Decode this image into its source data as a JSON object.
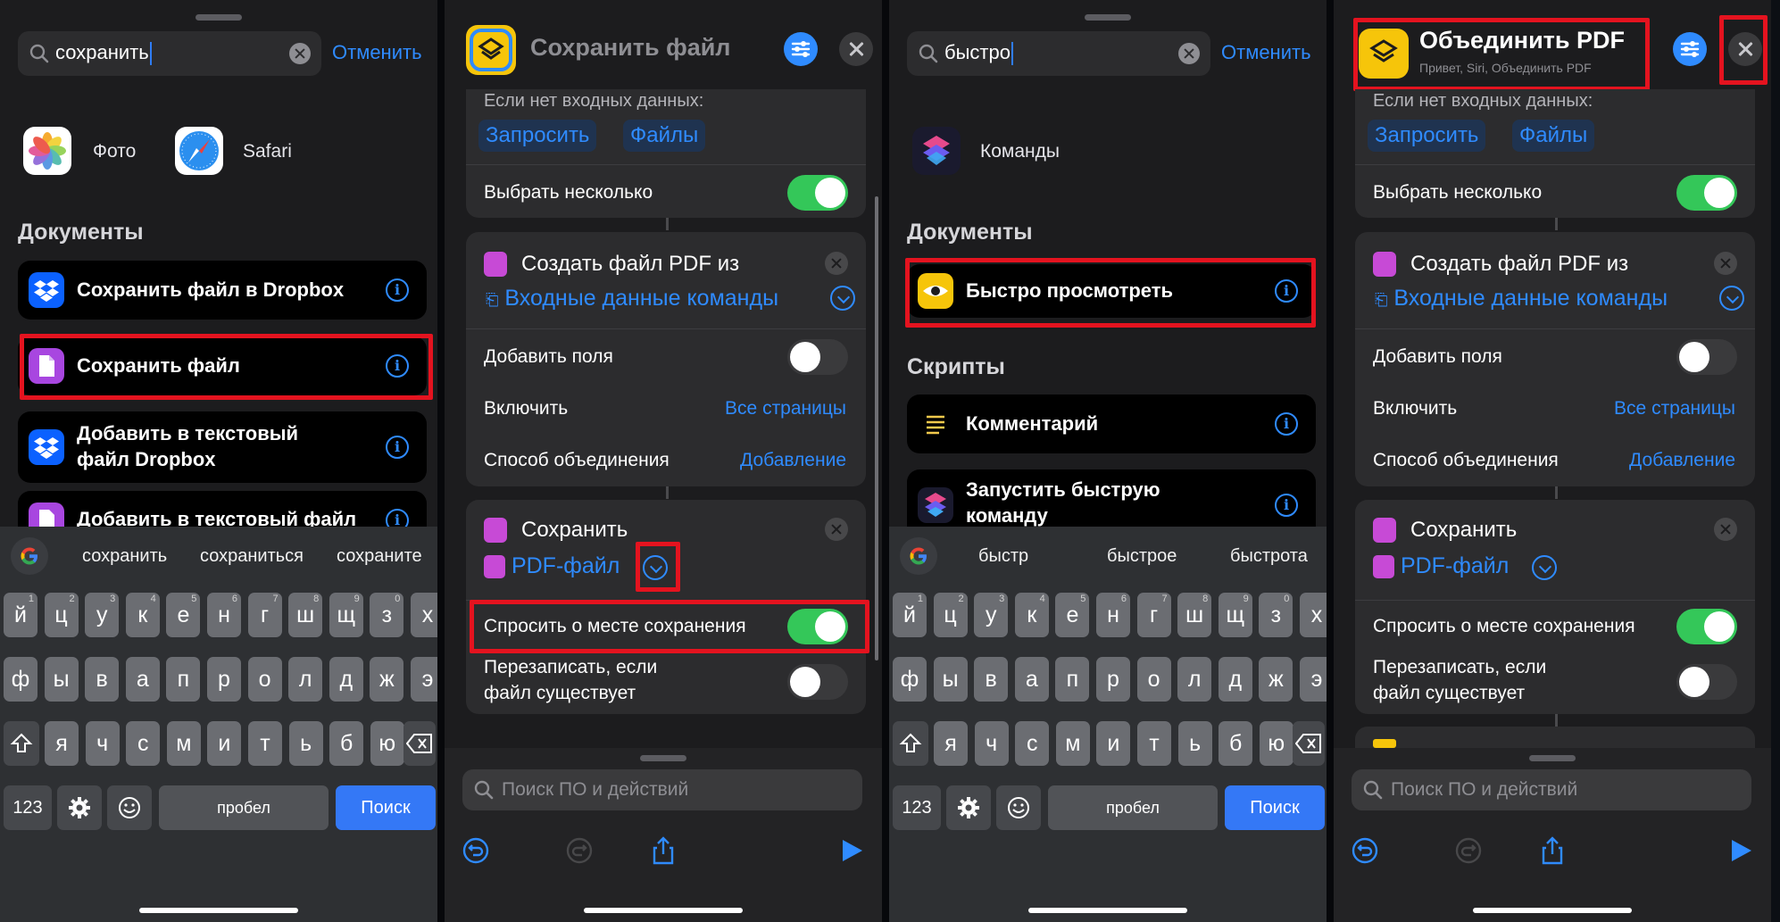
{
  "accent": "#2f8bff",
  "highlight": "#e4131f",
  "panel1": {
    "search_query": "сохранить",
    "cancel_label": "Отменить",
    "apps": [
      {
        "label": "Фото",
        "icon": "photos-icon"
      },
      {
        "label": "Safari",
        "icon": "safari-icon"
      }
    ],
    "section_documents": "Документы",
    "actions": [
      {
        "label": "Сохранить файл в Dropbox",
        "icon": "dropbox-icon"
      },
      {
        "label": "Сохранить файл",
        "icon": "file-icon"
      },
      {
        "label_line1": "Добавить в текстовый",
        "label_line2": "файл Dropbox",
        "icon": "dropbox-icon"
      },
      {
        "label": "Добавить в текстовый файл",
        "icon": "file-icon"
      }
    ],
    "suggestions": [
      "сохранить",
      "сохраниться",
      "сохраните"
    ]
  },
  "panel3": {
    "search_query": "быстро",
    "cancel_label": "Отменить",
    "apps": [
      {
        "label": "Команды",
        "icon": "shortcuts-icon"
      }
    ],
    "section_documents": "Документы",
    "section_scripts": "Скрипты",
    "actions": [
      {
        "label": "Быстро просмотреть",
        "icon": "quicklook-icon"
      },
      {
        "label": "Комментарий",
        "icon": "comment-icon"
      },
      {
        "label_line1": "Запустить быструю",
        "label_line2": "команду",
        "icon": "shortcuts-icon"
      }
    ],
    "suggestions": [
      "быстр",
      "быстрое",
      "быстрота"
    ]
  },
  "keyboard": {
    "row1": [
      "й",
      "ц",
      "у",
      "к",
      "е",
      "н",
      "г",
      "ш",
      "щ",
      "з",
      "х"
    ],
    "row1_nums": [
      "1",
      "2",
      "3",
      "4",
      "5",
      "6",
      "7",
      "8",
      "9",
      "0",
      ""
    ],
    "row2": [
      "ф",
      "ы",
      "в",
      "а",
      "п",
      "р",
      "о",
      "л",
      "д",
      "ж",
      "э"
    ],
    "row3": [
      "я",
      "ч",
      "с",
      "м",
      "и",
      "т",
      "ь",
      "б",
      "ю"
    ],
    "numbers_label": "123",
    "space_label": "пробел",
    "search_label": "Поиск"
  },
  "panel2": {
    "title": "Сохранить файл"
  },
  "panel4": {
    "title": "Объединить PDF",
    "subtitle": "Привет, Siri, Объединить PDF"
  },
  "editor": {
    "no_input_label": "Если нет входных данных:",
    "ask_chip": "Запросить",
    "files_chip": "Файлы",
    "select_multiple": "Выбрать несколько",
    "create_pdf_title": "Создать файл PDF из",
    "shortcut_input": "Входные данные команды",
    "add_margins": "Добавить поля",
    "include_label": "Включить",
    "include_value": "Все страницы",
    "merge_label": "Способ объединения",
    "merge_value": "Добавление",
    "save_title": "Сохранить",
    "pdf_file": "PDF-файл",
    "ask_location": "Спросить о месте сохранения",
    "overwrite_line1": "Перезаписать, если",
    "overwrite_line2": "файл существует",
    "bottom_search_placeholder": "Поиск ПО и действий"
  }
}
